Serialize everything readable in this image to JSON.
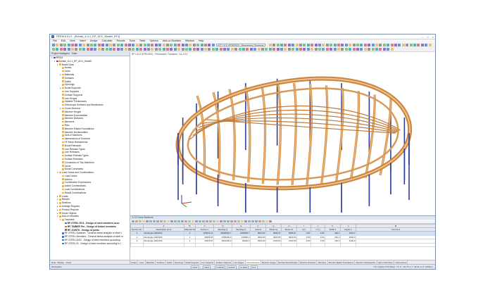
{
  "window": {
    "title": "RFEM 6.01.0 - [Schale_6-4.1_EP_ACC_Modell_RF1]",
    "controls": [
      "–",
      "□",
      "×"
    ]
  },
  "menu": [
    "File",
    "Edit",
    "View",
    "Insert",
    "Assign",
    "Calculate",
    "Results",
    "Tools",
    "Table",
    "Options",
    "Add-on Modules",
    "Window",
    "Help"
  ],
  "toolbar": {
    "load_combo": "ACC   ULS (STR/GEO) - Permanent / Transient",
    "colors": [
      "#3a78c9",
      "#d9534f",
      "#5cb85c",
      "#f0ad4e",
      "#6f42c1",
      "#20a0a0",
      "#777777"
    ]
  },
  "navigator": {
    "title": "Project Navigator - Data",
    "tabs": [
      "Data",
      "Display",
      "Views"
    ],
    "tree": [
      {
        "level": 0,
        "exp": "▾",
        "label": "RFEM",
        "icon": "#2d5fa0"
      },
      {
        "level": 1,
        "exp": "▾",
        "label": "Schale_6-4.1_EP_ACC_Modell",
        "icon": "#c0392b"
      },
      {
        "level": 2,
        "exp": "▾",
        "label": "Model Data",
        "icon": "#e0b84d"
      },
      {
        "level": 3,
        "exp": "",
        "label": "Nodes",
        "icon": "#e0b84d"
      },
      {
        "level": 3,
        "exp": "",
        "label": "Lines",
        "icon": "#e0b84d"
      },
      {
        "level": 3,
        "exp": "▸",
        "label": "Materials",
        "icon": "#e0b84d"
      },
      {
        "level": 3,
        "exp": "",
        "label": "Surfaces",
        "icon": "#e0b84d"
      },
      {
        "level": 3,
        "exp": "",
        "label": "Solids",
        "icon": "#e0b84d"
      },
      {
        "level": 3,
        "exp": "",
        "label": "Openings",
        "icon": "#e0b84d"
      },
      {
        "level": 3,
        "exp": "▸",
        "label": "Nodal Supports",
        "icon": "#e0b84d"
      },
      {
        "level": 3,
        "exp": "",
        "label": "Line Supports",
        "icon": "#e0b84d"
      },
      {
        "level": 3,
        "exp": "",
        "label": "Surface Supports",
        "icon": "#e0b84d"
      },
      {
        "level": 3,
        "exp": "",
        "label": "Line Hinges",
        "icon": "#e0b84d"
      },
      {
        "level": 3,
        "exp": "",
        "label": "Variable Thicknesses",
        "icon": "#e0b84d"
      },
      {
        "level": 3,
        "exp": "",
        "label": "Orthotropic Surfaces and Membranes",
        "icon": "#e0b84d"
      },
      {
        "level": 3,
        "exp": "▸",
        "label": "Cross-Sections",
        "icon": "#e0b84d"
      },
      {
        "level": 3,
        "exp": "",
        "label": "Member Hinges",
        "icon": "#e0b84d"
      },
      {
        "level": 3,
        "exp": "",
        "label": "Member Eccentricities",
        "icon": "#e0b84d"
      },
      {
        "level": 3,
        "exp": "",
        "label": "Member Divisions",
        "icon": "#e0b84d"
      },
      {
        "level": 3,
        "exp": "",
        "label": "Members",
        "icon": "#e0b84d"
      },
      {
        "level": 3,
        "exp": "",
        "label": "Ribs",
        "icon": "#e0b84d"
      },
      {
        "level": 3,
        "exp": "",
        "label": "Member Elastic Foundations",
        "icon": "#e0b84d"
      },
      {
        "level": 3,
        "exp": "",
        "label": "Member Nonlinearities",
        "icon": "#e0b84d"
      },
      {
        "level": 3,
        "exp": "",
        "label": "Sets of Members",
        "icon": "#e0b84d"
      },
      {
        "level": 3,
        "exp": "",
        "label": "Intersections of Surfaces",
        "icon": "#e0b84d"
      },
      {
        "level": 3,
        "exp": "",
        "label": "FE Mesh Refinements",
        "icon": "#e0b84d"
      },
      {
        "level": 3,
        "exp": "",
        "label": "Nodal Releases",
        "icon": "#e0b84d"
      },
      {
        "level": 3,
        "exp": "",
        "label": "Line Release Types",
        "icon": "#e0b84d"
      },
      {
        "level": 3,
        "exp": "",
        "label": "Line Releases",
        "icon": "#e0b84d"
      },
      {
        "level": 3,
        "exp": "",
        "label": "Surface Release Types",
        "icon": "#e0b84d"
      },
      {
        "level": 3,
        "exp": "",
        "label": "Surface Releases",
        "icon": "#e0b84d"
      },
      {
        "level": 3,
        "exp": "",
        "label": "Connection of Two Members",
        "icon": "#e0b84d"
      },
      {
        "level": 3,
        "exp": "",
        "label": "Joints",
        "icon": "#e0b84d"
      },
      {
        "level": 3,
        "exp": "",
        "label": "Nodal Constraints",
        "icon": "#e0b84d"
      },
      {
        "level": 2,
        "exp": "▾",
        "label": "Load Cases and Combinations",
        "icon": "#e0b84d"
      },
      {
        "level": 3,
        "exp": "",
        "label": "Load Cases",
        "icon": "#e0b84d"
      },
      {
        "level": 3,
        "exp": "",
        "label": "Actions",
        "icon": "#e0b84d"
      },
      {
        "level": 3,
        "exp": "",
        "label": "Combination Expressions",
        "icon": "#e0b84d"
      },
      {
        "level": 3,
        "exp": "",
        "label": "Action Combinations",
        "icon": "#e0b84d"
      },
      {
        "level": 3,
        "exp": "",
        "label": "Load Combinations",
        "icon": "#e0b84d"
      },
      {
        "level": 3,
        "exp": "",
        "label": "Result Combinations",
        "icon": "#e0b84d"
      },
      {
        "level": 2,
        "exp": "▸",
        "label": "Loads",
        "icon": "#e0b84d"
      },
      {
        "level": 2,
        "exp": "▸",
        "label": "Results",
        "icon": "#e0b84d"
      },
      {
        "level": 2,
        "exp": "▸",
        "label": "Sections",
        "icon": "#e0b84d"
      },
      {
        "level": 2,
        "exp": "▸",
        "label": "Average Regions",
        "icon": "#e0b84d"
      },
      {
        "level": 2,
        "exp": "▸",
        "label": "Printout Reports",
        "icon": "#e0b84d"
      },
      {
        "level": 2,
        "exp": "▸",
        "label": "Guide Objects",
        "icon": "#e0b84d"
      },
      {
        "level": 2,
        "exp": "▾",
        "label": "Add-on Modules",
        "icon": "#e0b84d"
      },
      {
        "level": 3,
        "exp": "▾",
        "label": "Favorites",
        "icon": "#e0b84d"
      },
      {
        "level": 4,
        "exp": "",
        "label": "RF-STEEL EC3 - Design of steel members acco",
        "icon": "#3a78c9",
        "bold": true
      },
      {
        "level": 4,
        "exp": "",
        "label": "RF-TIMBER Pro - Design of timber members",
        "icon": "#b9772f",
        "bold": true
      },
      {
        "level": 4,
        "exp": "",
        "label": "RF-JOINTS - Design of joints",
        "icon": "#777777",
        "bold": true
      },
      {
        "level": 3,
        "exp": "",
        "label": "RF-STEEL Surfaces - General stress analysis of steel s",
        "icon": "#3a78c9"
      },
      {
        "level": 3,
        "exp": "",
        "label": "RF-STEEL Members - General stress analysis of steel m",
        "icon": "#3a78c9"
      },
      {
        "level": 3,
        "exp": "",
        "label": "RF-STEEL AISC - Design of steel members according",
        "icon": "#3a78c9"
      },
      {
        "level": 3,
        "exp": "",
        "label": "RF-STEEL IS - Design of steel members according to I",
        "icon": "#3a78c9"
      }
    ]
  },
  "viewport": {
    "header": "RF1   ULS (STR/GEO) - Permanent / Transient - Eq. 6.10",
    "axes": {
      "x": "X",
      "y": "Y",
      "z": "Z"
    }
  },
  "table": {
    "title": "1.13 Cross-Sections",
    "group_headers": [
      "",
      "Cross-Section",
      "Material",
      "Moments of Inertia [cm4]",
      "Cross-Sectional Areas [cm2]",
      "Principal Axes",
      "Rotation",
      "Overall Dimensions [mm]",
      ""
    ],
    "column_letters": [
      "A",
      "B",
      "C",
      "D",
      "E",
      "F",
      "G",
      "H",
      "I",
      "J",
      "K",
      "L",
      "M"
    ],
    "headers": [
      "Section No.",
      "Description [mm]",
      "Material No.",
      "Torsion Iₜ",
      "Bending Iy",
      "Bending Iz",
      "Axial A",
      "Shear Ay",
      "Shear Az",
      "α [°]",
      "α' [°]",
      "Width b",
      "Depth h",
      "Comment"
    ],
    "rows": [
      {
        "no": "1",
        "desc": "Rectangle 400/2000",
        "mat": "1",
        "it": "625631.14",
        "iy": "26666666.7",
        "iz": "1066666.7",
        "a": "8000.00",
        "ay": "6666.67",
        "az": "6666.67",
        "al": "0.00",
        "al2": "0.00",
        "b": "400.0",
        "h": "2000.0",
        "comment": ""
      },
      {
        "no": "2",
        "desc": "Rectangle 240/1500",
        "mat": "1",
        "it": "93609.00",
        "iy": "6750000.0",
        "iz": "172800.0",
        "a": "3600.00",
        "ay": "3000.00",
        "az": "3000.00",
        "al": "0.00",
        "al2": "0.00",
        "b": "240.0",
        "h": "1500.0",
        "comment": ""
      },
      {
        "no": "3",
        "desc": "Rectangle 120/2100",
        "mat": "1",
        "it": "19415.97",
        "iy": "9261000.0",
        "iz": "30240.0",
        "a": "2520.00",
        "ay": "2100.00",
        "az": "2100.00",
        "al": "0.00",
        "al2": "0.00",
        "b": "120.0",
        "h": "2100.0",
        "comment": ""
      },
      {
        "no": "",
        "desc": "",
        "mat": "",
        "it": "",
        "iy": "",
        "iz": "",
        "a": "",
        "ay": "",
        "az": "",
        "al": "",
        "al2": "",
        "b": "",
        "h": "",
        "comment": ""
      }
    ],
    "tabs": [
      "Nodes",
      "Lines",
      "Materials",
      "Surfaces",
      "Solids",
      "Openings",
      "Nodal Supports",
      "Line Supports",
      "Surface Supports",
      "Line Hinges",
      "Cross-Sections",
      "Member Hinges",
      "Member Eccentricities",
      "Member Divisions",
      "Members",
      "Member Elastic Foundations",
      "Member Nonlinearities",
      "Sets of Members",
      "Intersections"
    ],
    "active_tab": "Cross-Sections"
  },
  "status": {
    "left": "Workplane",
    "buttons": [
      "SNAP",
      "GRID",
      "CARTES",
      "OSNAP",
      "GLINES",
      "DXF"
    ],
    "right": "CS: Global XYZ     Plane: YX     X: -13.73 m   Y: 42.21 m   Z: 0.000 m"
  }
}
